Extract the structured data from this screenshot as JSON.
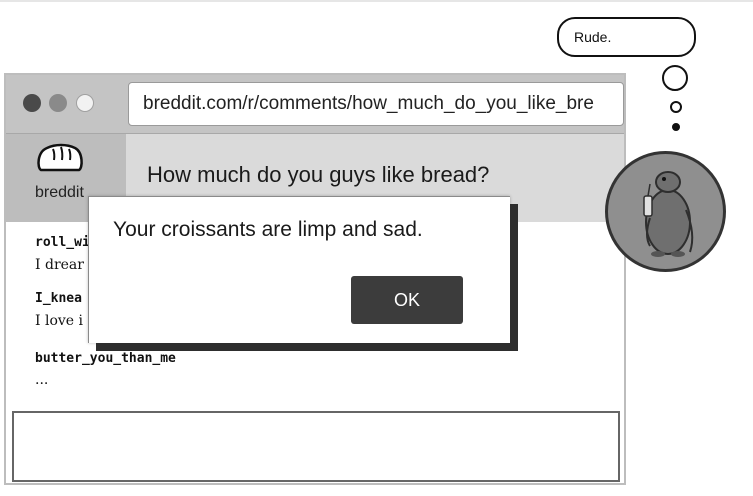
{
  "browser": {
    "url": "breddit.com/r/comments/how_much_do_you_like_bre",
    "logo_text": "breddit",
    "post_title": "How much do you guys like bread?"
  },
  "comments": [
    {
      "user": "roll_wi",
      "text": "I drear"
    },
    {
      "user": "I_knea",
      "text": "I love i"
    },
    {
      "user": "butter_you_than_me",
      "text": "..."
    }
  ],
  "reply": {
    "value": ""
  },
  "alert": {
    "message": "Your croissants are limp and sad.",
    "ok_label": "OK"
  },
  "thought": {
    "text": "Rude."
  },
  "colors": {
    "chrome": "#c4c4c4",
    "header": "#dadada",
    "button": "#3c3c3c",
    "avatar_bg": "#8f8f8f"
  }
}
